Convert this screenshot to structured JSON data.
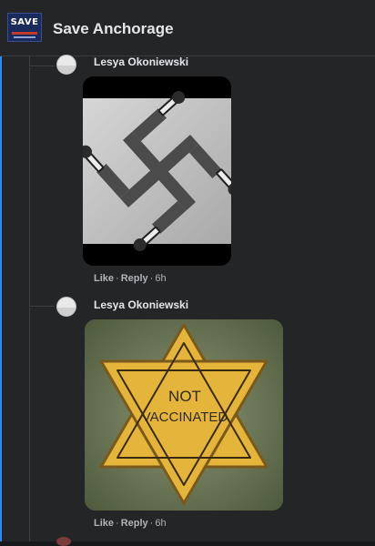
{
  "header": {
    "group_logo_text": "SAVE",
    "group_title": "Save Anchorage"
  },
  "comments": [
    {
      "author": "Lesya Okoniewski",
      "image_icon": "swastika-syringe-image",
      "actions": {
        "like": "Like",
        "reply": "Reply",
        "time": "6h"
      }
    },
    {
      "author": "Lesya Okoniewski",
      "image_icon": "star-patch-image",
      "image_text_line1": "NOT",
      "image_text_line2": "VACCINATED",
      "actions": {
        "like": "Like",
        "reply": "Reply",
        "time": "6h"
      }
    }
  ],
  "colors": {
    "background": "#242526",
    "header": "#242526",
    "accent_edge": "#2d88ff",
    "text_primary": "#e4e6eb",
    "text_secondary": "#b0b3b8"
  }
}
